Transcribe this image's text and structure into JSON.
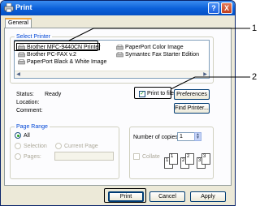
{
  "window": {
    "title": "Print",
    "help_label": "?",
    "close_label": "X"
  },
  "tabs": [
    {
      "label": "General"
    }
  ],
  "select_printer": {
    "legend": "Select Printer",
    "printers": [
      {
        "name": "Brother MFC-9440CN Printer",
        "selected": true
      },
      {
        "name": "PaperPort Color Image",
        "selected": false
      },
      {
        "name": "Brother PC-FAX v.2",
        "selected": false
      },
      {
        "name": "Symantec Fax Starter Edition",
        "selected": false
      },
      {
        "name": "PaperPort Black & White Image",
        "selected": false
      }
    ],
    "scroll_left": "◀",
    "scroll_right": "▶"
  },
  "status": {
    "status_label": "Status:",
    "status_value": "Ready",
    "location_label": "Location:",
    "comment_label": "Comment:"
  },
  "options": {
    "print_to_file_label": "Print to file",
    "print_to_file_checked": true,
    "check_mark": "✓",
    "preferences_label": "Preferences",
    "find_printer_label": "Find Printer..."
  },
  "page_range": {
    "legend": "Page Range",
    "all_label": "All",
    "selection_label": "Selection",
    "current_page_label": "Current Page",
    "pages_label": "Pages:",
    "pages_value": ""
  },
  "copies": {
    "number_label": "Number of copies:",
    "number_value": "1",
    "spin_up": "▲",
    "spin_down": "▼",
    "collate_label": "Collate",
    "collate_pages": [
      "1",
      "1",
      "2",
      "2",
      "3",
      "3"
    ]
  },
  "footer": {
    "print_label": "Print",
    "cancel_label": "Cancel",
    "apply_label": "Apply"
  },
  "callouts": {
    "one": "1",
    "two": "2"
  }
}
